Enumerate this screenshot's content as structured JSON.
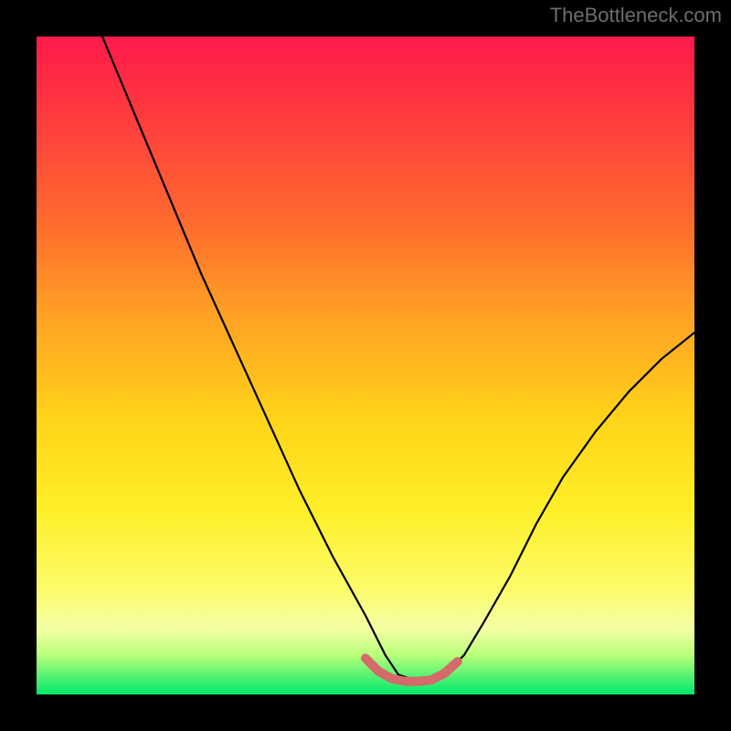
{
  "watermark": "TheBottleneck.com",
  "chart_data": {
    "type": "line",
    "title": "",
    "xlabel": "",
    "ylabel": "",
    "xlim": [
      0,
      100
    ],
    "ylim": [
      0,
      100
    ],
    "series": [
      {
        "name": "bottleneck-curve",
        "x": [
          10,
          15,
          20,
          25,
          30,
          35,
          40,
          45,
          50,
          53,
          55,
          58,
          60,
          62,
          65,
          68,
          72,
          76,
          80,
          85,
          90,
          95,
          100
        ],
        "values": [
          100,
          88,
          76,
          64,
          53,
          42,
          31,
          21,
          12,
          6,
          3,
          2,
          2,
          3,
          6,
          11,
          18,
          26,
          33,
          40,
          46,
          51,
          55
        ]
      },
      {
        "name": "trough-highlight",
        "x": [
          50,
          52,
          54,
          56,
          58,
          60,
          62,
          64
        ],
        "values": [
          5.5,
          3.5,
          2.4,
          2.0,
          2.0,
          2.2,
          3.2,
          5.0
        ]
      }
    ],
    "gradient_stops": [
      {
        "pos": 0,
        "color": "#ff1a4b"
      },
      {
        "pos": 12,
        "color": "#ff3a3e"
      },
      {
        "pos": 28,
        "color": "#ff6a2e"
      },
      {
        "pos": 42,
        "color": "#ffa024"
      },
      {
        "pos": 58,
        "color": "#ffd319"
      },
      {
        "pos": 72,
        "color": "#ffef28"
      },
      {
        "pos": 84,
        "color": "#fcfc6a"
      },
      {
        "pos": 90,
        "color": "#f4ffa6"
      },
      {
        "pos": 94,
        "color": "#b8ff7a"
      },
      {
        "pos": 100,
        "color": "#00e86b"
      }
    ],
    "trough_color": "#d46a6a",
    "curve_color": "#000000"
  }
}
